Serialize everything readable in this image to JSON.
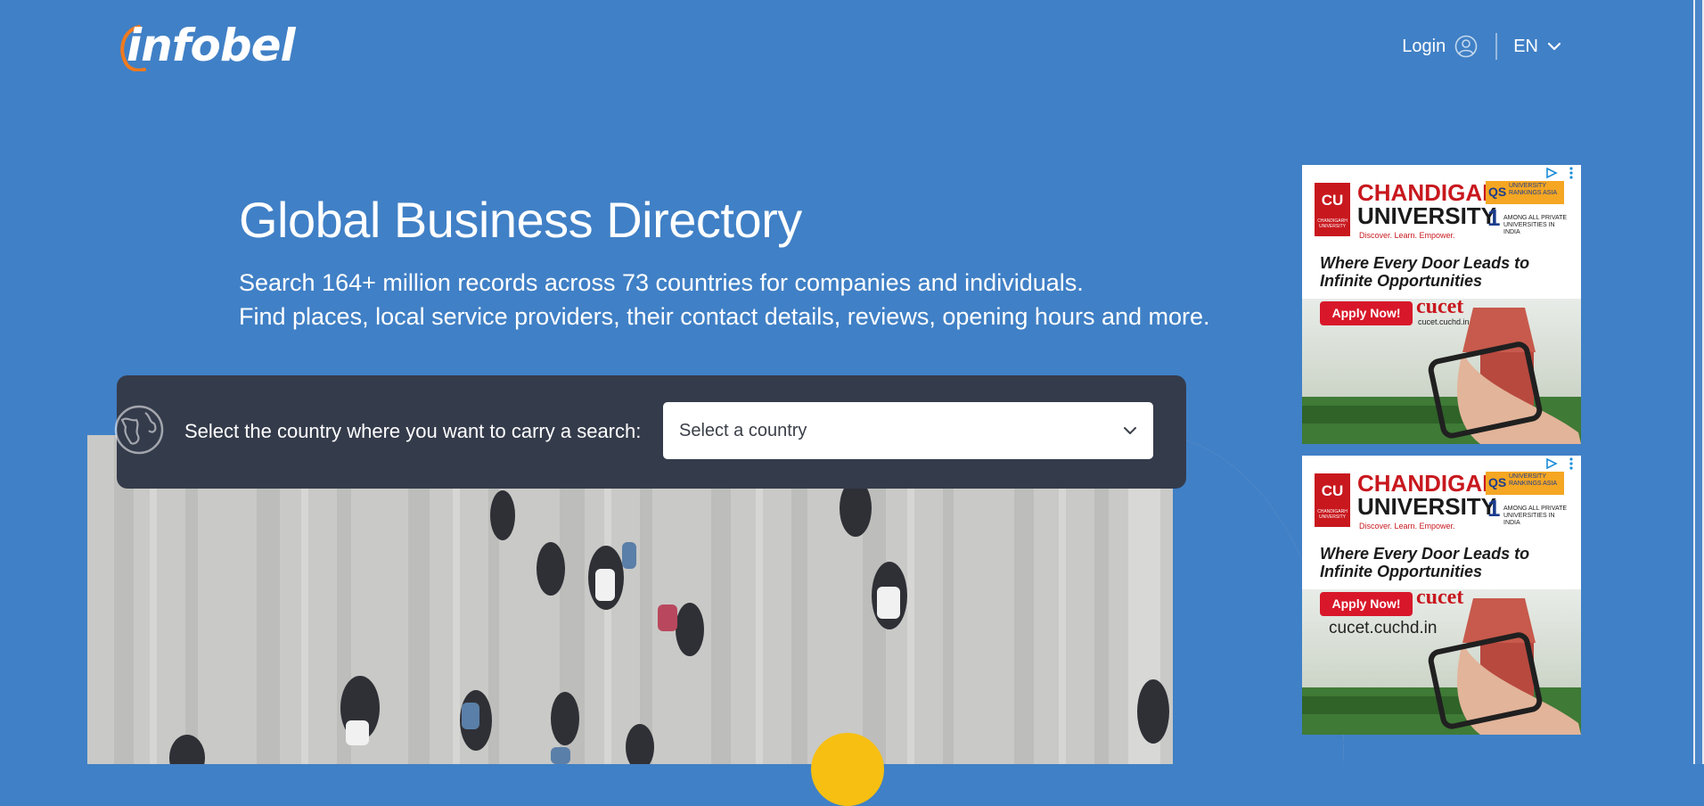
{
  "header": {
    "logo_text": "infobel",
    "login_label": "Login",
    "language_label": "EN"
  },
  "hero": {
    "title": "Global Business Directory",
    "subtitle_line1": "Search 164+ million records across 73 countries for companies and individuals.",
    "subtitle_line2": "Find places, local service providers, their contact details, reviews, opening hours and more."
  },
  "search": {
    "label": "Select the country where you want to carry a search:",
    "select_value": "Select a country"
  },
  "ads": [
    {
      "brand_line1": "CHANDIGARH",
      "brand_line2": "UNIVERSITY",
      "logo_text": "CU",
      "logo_sub": "CHANDIGARH UNIVERSITY",
      "motto": "Discover. Learn. Empower.",
      "qs_label": "QS",
      "qs_text": "UNIVERSITY RANKINGS ASIA",
      "rank_number": "1",
      "rank_text": "AMONG ALL PRIVATE UNIVERSITIES IN INDIA",
      "headline": "Where Every Door Leads to Infinite Opportunities",
      "cta": "Apply Now!",
      "cucet": "cucet",
      "url": "cucet.cuchd.in"
    },
    {
      "brand_line1": "CHANDIGARH",
      "brand_line2": "UNIVERSITY",
      "logo_text": "CU",
      "logo_sub": "CHANDIGARH UNIVERSITY",
      "motto": "Discover. Learn. Empower.",
      "qs_label": "QS",
      "qs_text": "UNIVERSITY RANKINGS ASIA",
      "rank_number": "1",
      "rank_text": "AMONG ALL PRIVATE UNIVERSITIES IN INDIA",
      "headline": "Where Every Door Leads to Infinite Opportunities",
      "cta": "Apply Now!",
      "cucet": "cucet",
      "url": "cucet.cuchd.in"
    }
  ],
  "colors": {
    "background": "#4080c6",
    "search_panel": "#343b4b",
    "logo_accent": "#f07a1e",
    "ad_red": "#c8181e",
    "yellow": "#f7bf11"
  }
}
